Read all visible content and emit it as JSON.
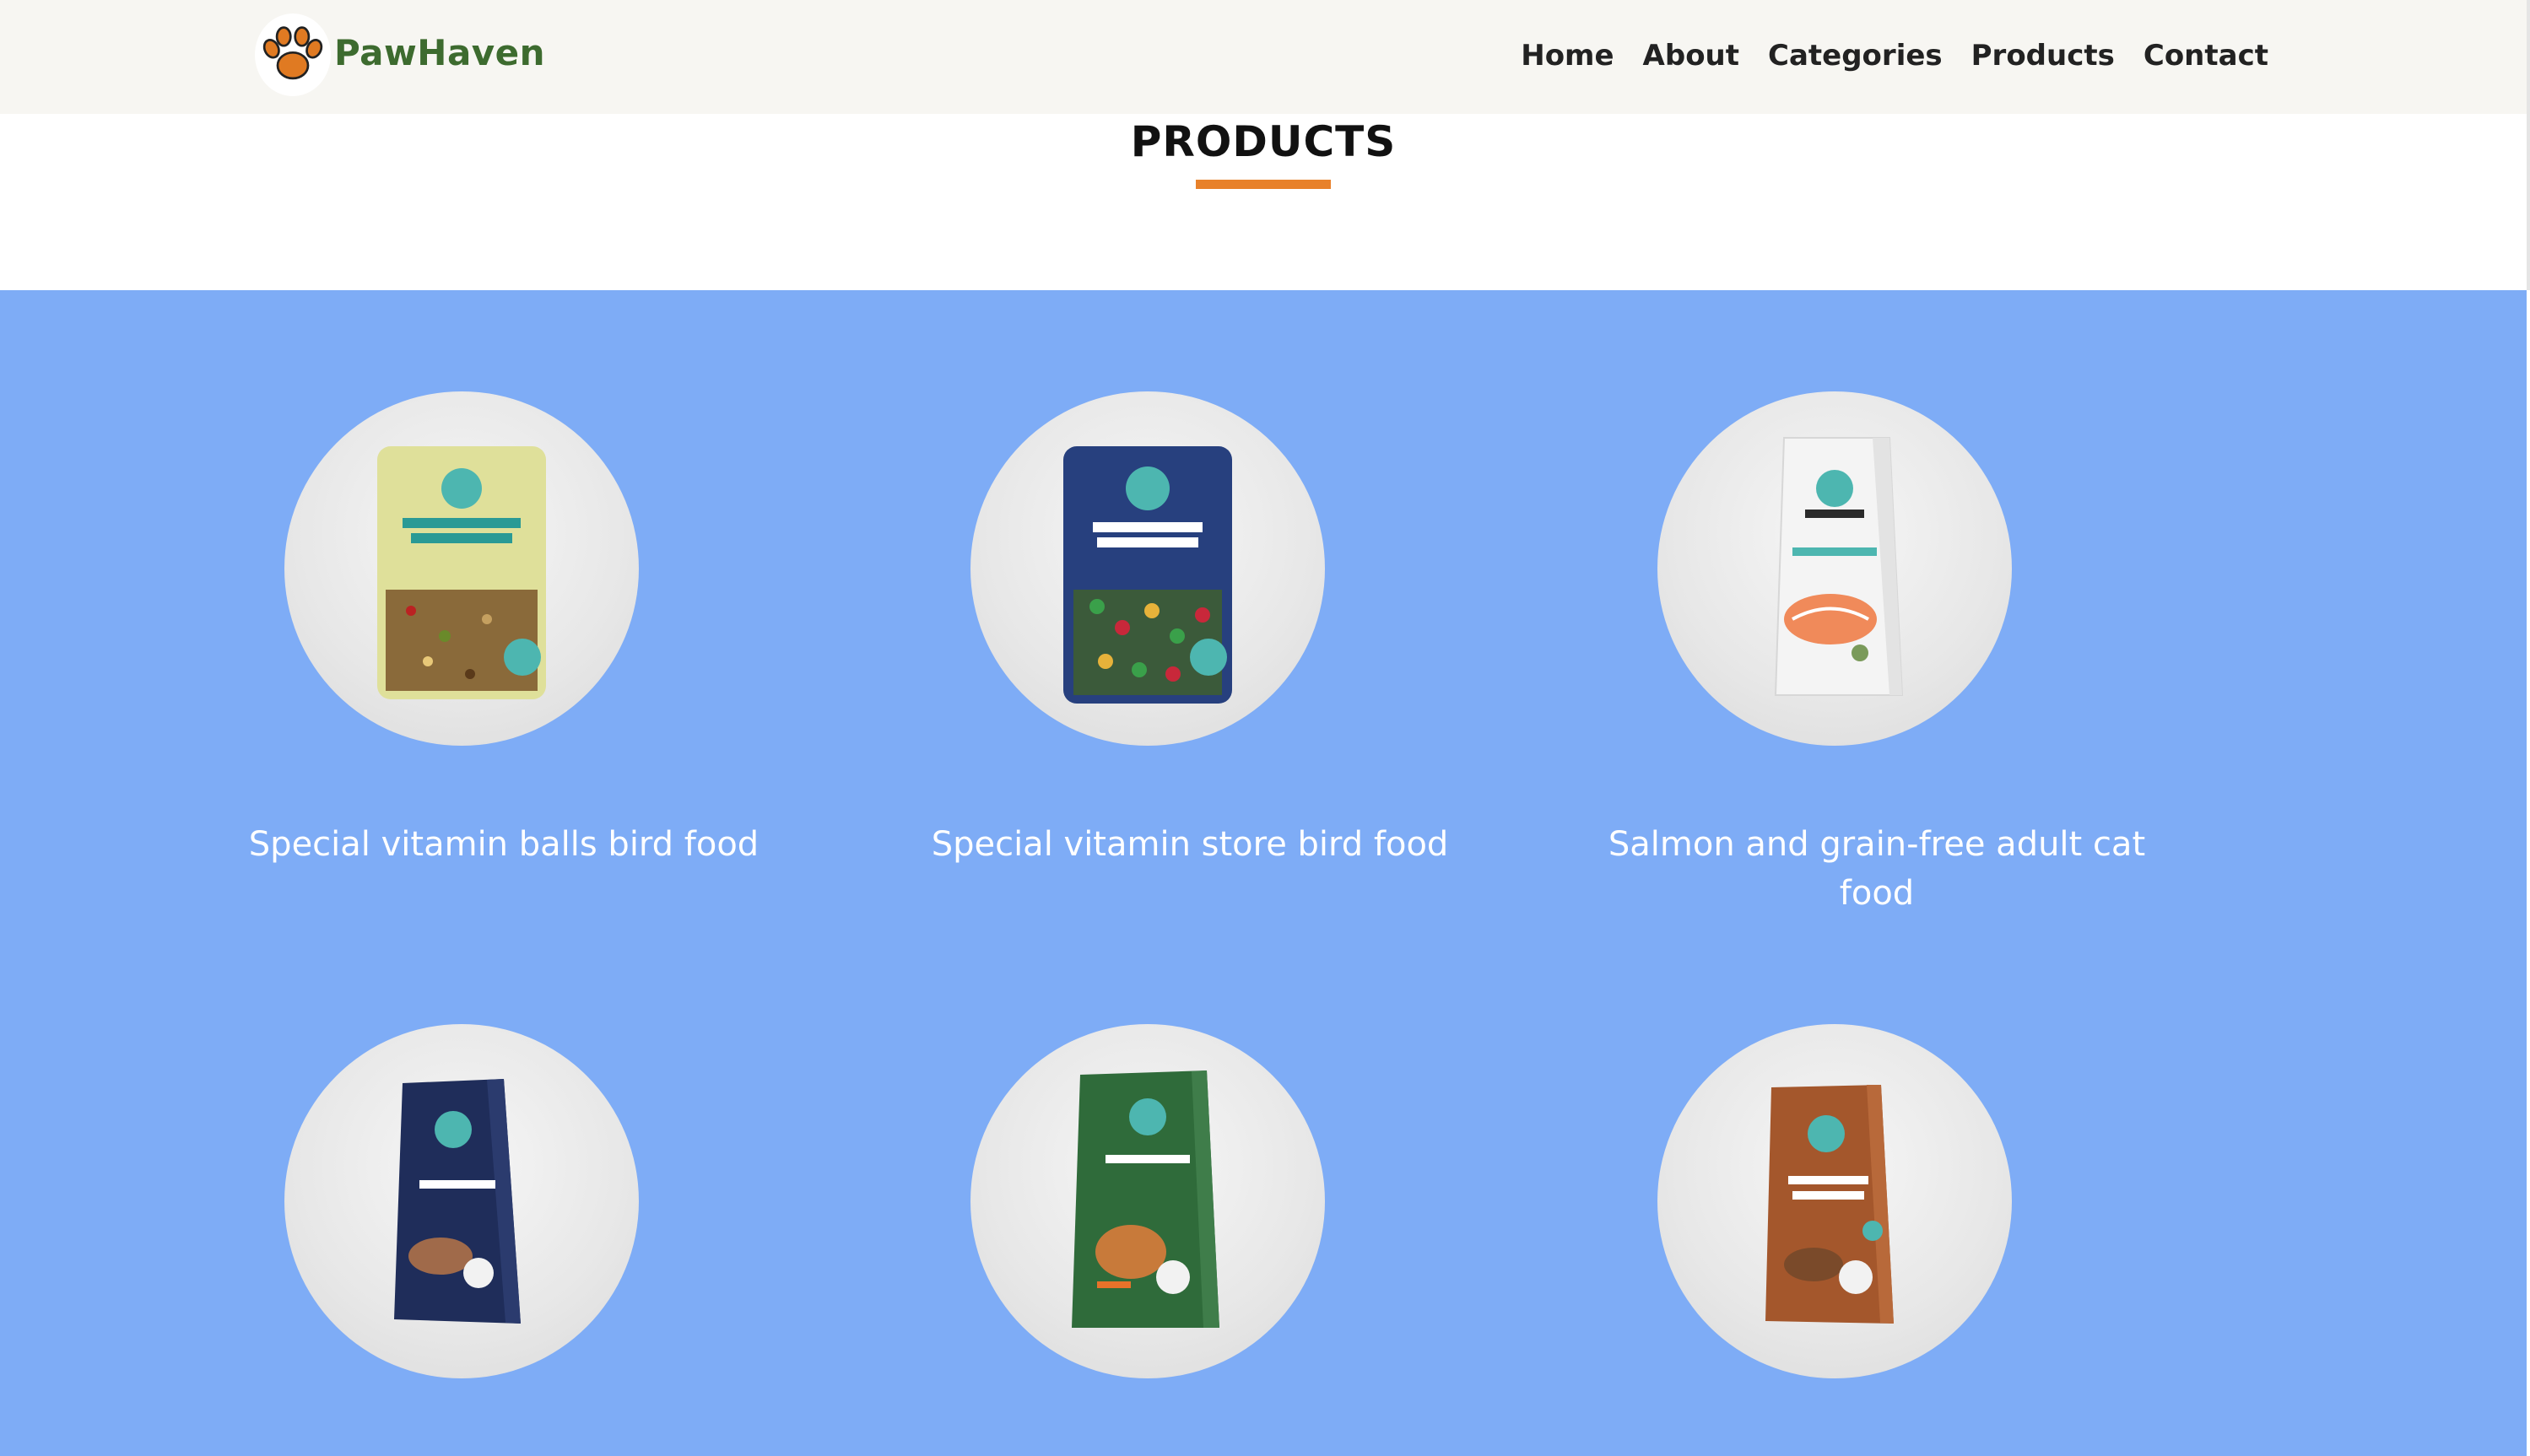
{
  "brand": {
    "name": "PawHaven",
    "logo_icon": "paw-logo-icon"
  },
  "nav": {
    "items": [
      "Home",
      "About",
      "Categories",
      "Products",
      "Contact"
    ]
  },
  "page": {
    "title": "PRODUCTS"
  },
  "products": [
    {
      "name": "Special vitamin balls bird food",
      "image_icon": "bird-food-bag-yellow-image"
    },
    {
      "name": "Special vitamin store bird food",
      "image_icon": "bird-food-bag-blue-image"
    },
    {
      "name": "Salmon and grain-free adult cat food",
      "image_icon": "cat-food-bag-white-image"
    },
    {
      "name": "",
      "image_icon": "cat-food-bag-navy-image"
    },
    {
      "name": "",
      "image_icon": "dog-food-bag-green-image"
    },
    {
      "name": "",
      "image_icon": "cat-food-bag-brown-image"
    }
  ],
  "colors": {
    "brand_green": "#3d6b2f",
    "accent_orange": "#e8812a",
    "section_blue": "#7eacf6",
    "nav_bg": "#f7f6f2"
  }
}
